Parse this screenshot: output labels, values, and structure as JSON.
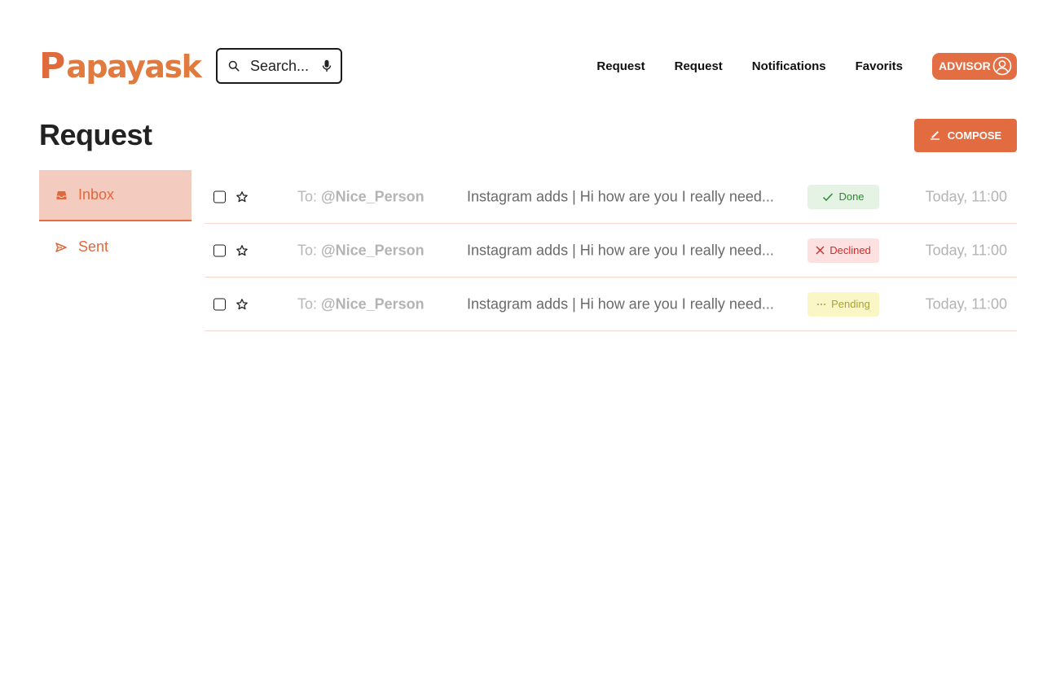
{
  "brand": {
    "logo_initial": "P",
    "logo_rest": "apayask",
    "accent": "#e36e43"
  },
  "search": {
    "placeholder": "Search...",
    "icon": "search-icon",
    "mic_icon": "microphone-icon"
  },
  "nav": {
    "links": [
      "Request",
      "Request",
      "Notifications",
      "Favorits"
    ],
    "advisor_label": "ADVISOR",
    "advisor_icon": "user-circle-icon"
  },
  "page": {
    "title": "Request",
    "compose_label": "COMPOSE",
    "compose_icon": "pencil-icon"
  },
  "sidebar": {
    "items": [
      {
        "label": "Inbox",
        "icon": "inbox-icon",
        "active": true
      },
      {
        "label": "Sent",
        "icon": "send-icon",
        "active": false
      }
    ]
  },
  "messages": [
    {
      "to_prefix": "To:",
      "recipient": "@Nice_Person",
      "subject": "Instagram adds |  Hi how are you I really need...",
      "status": "Done",
      "status_type": "done",
      "time": "Today, 11:00"
    },
    {
      "to_prefix": "To:",
      "recipient": "@Nice_Person",
      "subject": "Instagram adds |  Hi how are you I really need...",
      "status": "Declined",
      "status_type": "declined",
      "time": "Today, 11:00"
    },
    {
      "to_prefix": "To:",
      "recipient": "@Nice_Person",
      "subject": "Instagram adds |  Hi how are you I really need...",
      "status": "Pending",
      "status_type": "pending",
      "time": "Today, 11:00"
    }
  ],
  "status_colors": {
    "done": "#2f8a2f",
    "declined": "#cf2a2a",
    "pending": "#a8a235"
  }
}
